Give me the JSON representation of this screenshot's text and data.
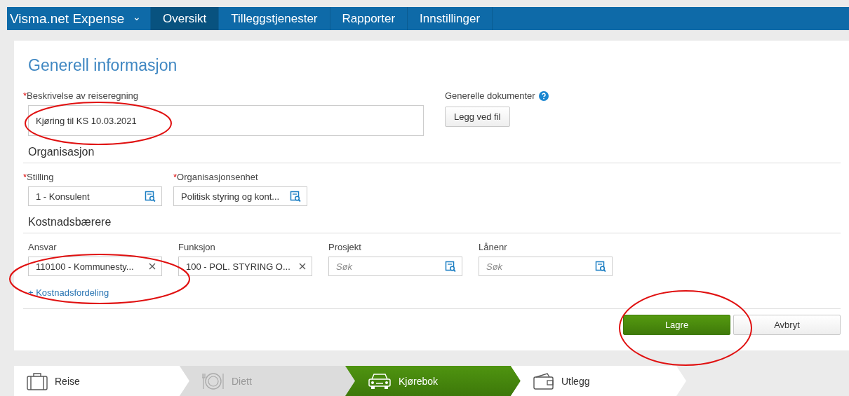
{
  "nav": {
    "brand": "Visma.net Expense",
    "caret": "⌄",
    "tabs": [
      {
        "label": "Oversikt",
        "selected": true
      },
      {
        "label": "Tilleggstjenester",
        "selected": false
      },
      {
        "label": "Rapporter",
        "selected": false
      },
      {
        "label": "Innstillinger",
        "selected": false
      }
    ]
  },
  "form": {
    "title": "Generell informasjon",
    "description": {
      "mark": "*",
      "label": "Beskrivelse av reiseregning",
      "value": "Kjøring til KS 10.03.2021"
    },
    "documents": {
      "label": "Generelle dokumenter",
      "button": "Legg ved fil"
    },
    "sections": [
      {
        "heading": "Organisasjon",
        "fields": [
          {
            "mark": "*",
            "label": "Stilling",
            "kind": "lookup",
            "value": "1 - Konsulent"
          },
          {
            "mark": "*",
            "label": "Organisasjonsenhet",
            "kind": "lookup",
            "value": "Politisk styring og kont..."
          }
        ]
      },
      {
        "heading": "Kostnadsbærere",
        "fields": [
          {
            "label": "Ansvar",
            "kind": "clearable",
            "value": "110100 - Kommunesty..."
          },
          {
            "label": "Funksjon",
            "kind": "clearable",
            "value": "100 - POL. STYRING O..."
          },
          {
            "label": "Prosjekt",
            "kind": "lookup",
            "placeholder": "Søk"
          },
          {
            "label": "Lånenr",
            "kind": "lookup",
            "placeholder": "Søk"
          }
        ],
        "link": "+ Kostnadsfordeling"
      }
    ],
    "buttons": [
      {
        "label": "Lagre",
        "kind": "primary"
      },
      {
        "label": "Avbryt",
        "kind": "secondary"
      }
    ]
  },
  "steps": [
    {
      "label": "Reise",
      "kind": "travel",
      "selected": false,
      "disabled": false
    },
    {
      "label": "Diett",
      "kind": "meals",
      "selected": false,
      "disabled": true
    },
    {
      "label": "Kjørebok",
      "kind": "driving",
      "selected": true,
      "disabled": false
    },
    {
      "label": "Utlegg",
      "kind": "expense",
      "selected": false,
      "disabled": false
    }
  ]
}
